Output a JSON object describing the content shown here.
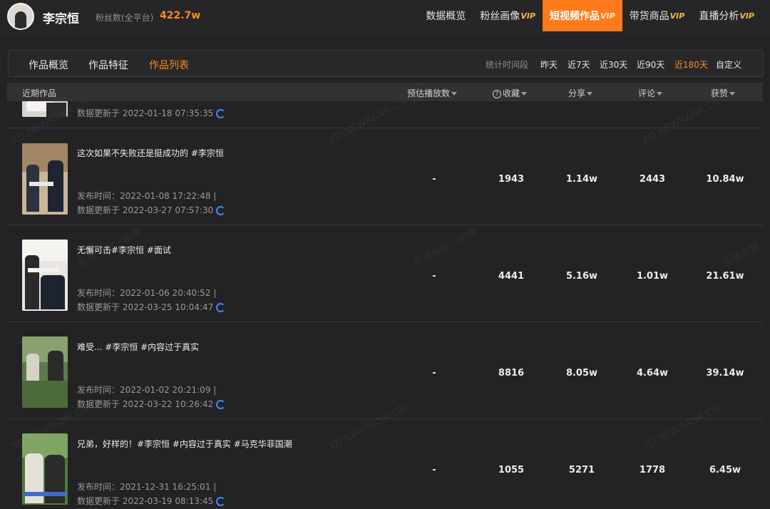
{
  "topbar": {
    "user_name": "李宗恒",
    "fans_label": "粉丝数(全平台)",
    "fans_value": "422.7w",
    "nav": [
      {
        "label": "数据概览",
        "vip": ""
      },
      {
        "label": "粉丝画像",
        "vip": "VIP"
      },
      {
        "label": "短视频作品",
        "vip": "VIP"
      },
      {
        "label": "带货商品",
        "vip": "VIP"
      },
      {
        "label": "直播分析",
        "vip": "VIP"
      }
    ],
    "active_nav": "短视频作品"
  },
  "subnav": {
    "tabs": [
      "作品概览",
      "作品特征",
      "作品列表"
    ],
    "active_tab": "作品列表",
    "period_label": "统计时间段",
    "periods": [
      "昨天",
      "近7天",
      "近30天",
      "近90天",
      "近180天",
      "自定义"
    ],
    "active_period": "近180天"
  },
  "table": {
    "columns": [
      "近期作品",
      "预估播放数",
      "收藏",
      "分享",
      "评论",
      "获赞"
    ],
    "partial_row": {
      "updated": "数据更新于 2022-01-18 07:35:35"
    },
    "rows": [
      {
        "title": "这次如果不失败还是挺成功的 #李宗恒",
        "published": "发布时间：2022-01-08 17:22:48 |",
        "updated": "数据更新于 2022-03-27 07:57:30",
        "plays": "-",
        "favorites": "1943",
        "shares": "1.14w",
        "comments": "2443",
        "likes": "10.84w"
      },
      {
        "title": "无懈可击#李宗恒 #面试",
        "published": "发布时间：2022-01-06 20:40:52 |",
        "updated": "数据更新于 2022-03-25 10:04:47",
        "plays": "-",
        "favorites": "4441",
        "shares": "5.16w",
        "comments": "1.01w",
        "likes": "21.61w"
      },
      {
        "title": "难受... #李宗恒 #内容过于真实",
        "published": "发布时间：2022-01-02 20:21:09 |",
        "updated": "数据更新于 2022-03-22 10:26:42",
        "plays": "-",
        "favorites": "8816",
        "shares": "8.05w",
        "comments": "4.64w",
        "likes": "39.14w"
      },
      {
        "title": "兄弟，好样的！#李宗恒 #内容过于真实 #马克华菲国潮",
        "published": "发布时间：2021-12-31 16:25:01 |",
        "updated": "数据更新于 2022-03-19 08:13:45",
        "plays": "-",
        "favorites": "1055",
        "shares": "5271",
        "comments": "1778",
        "likes": "6.45w"
      }
    ]
  },
  "watermarks": [
    "XD.NEWRANK.CN",
    "新榜有数 · 新榜"
  ],
  "colors": {
    "accent": "#ff7a1a",
    "vip": "#f5b84b",
    "refresh": "#3d8bff",
    "background": "#232325"
  }
}
